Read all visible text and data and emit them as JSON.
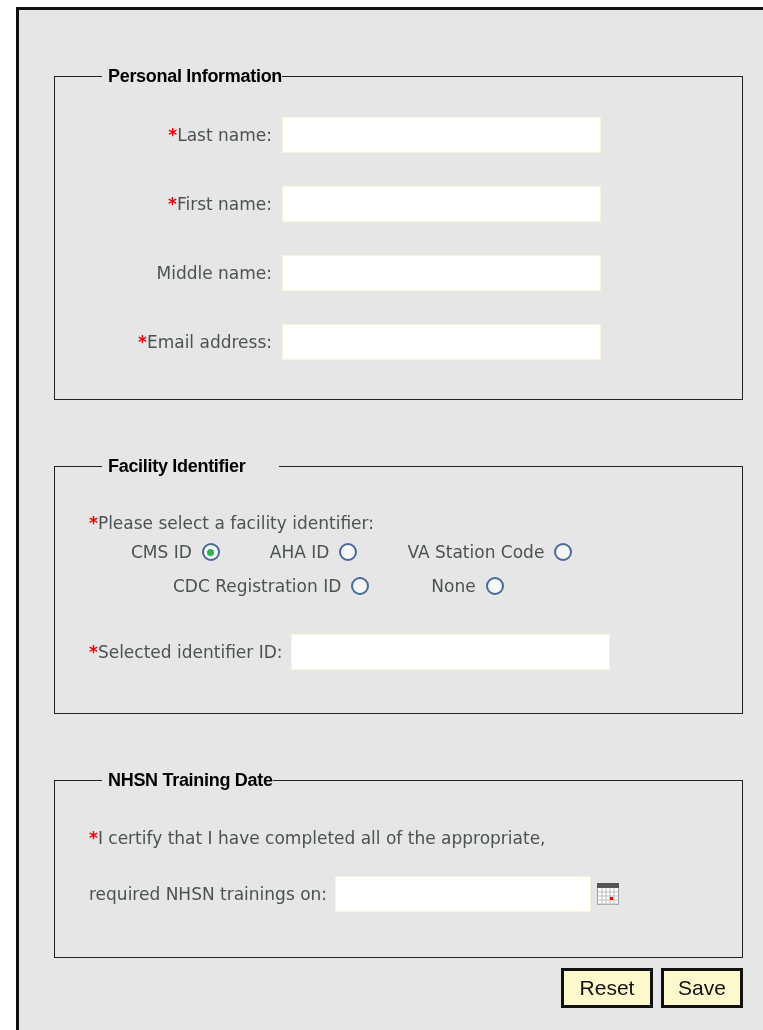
{
  "personal_information": {
    "legend": "Personal Information",
    "fields": [
      {
        "mark": "*",
        "label": "Last name:"
      },
      {
        "mark": "*",
        "label": "First name:"
      },
      {
        "label": "Middle name:"
      },
      {
        "mark": "*",
        "label": "Email address:"
      }
    ]
  },
  "facility_identifier": {
    "legend": "Facility Identifier",
    "prompt_mark": "*",
    "prompt": "Please select a facility identifier:",
    "option_rows": [
      [
        {
          "label": "CMS ID",
          "selected": true
        },
        {
          "label": "AHA ID",
          "selected": false
        },
        {
          "label": "VA Station Code",
          "selected": false
        }
      ],
      [
        {
          "label": "CDC Registration ID",
          "selected": false
        },
        {
          "label": "None",
          "selected": false
        }
      ]
    ],
    "id_field": {
      "mark": "*",
      "label": "Selected identifier ID:"
    }
  },
  "training_date": {
    "legend": "NHSN Training Date",
    "mark": "*",
    "line_1": "I certify that I have completed all of the appropriate,",
    "line_2": "required NHSN trainings on:"
  },
  "buttons": [
    "Reset",
    "Save"
  ]
}
